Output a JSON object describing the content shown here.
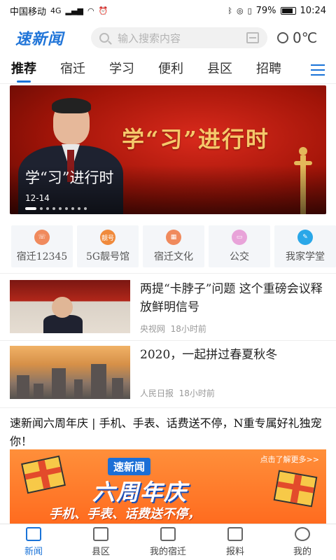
{
  "status": {
    "carrier": "中国移动",
    "network": "4G",
    "battery": "79%",
    "time": "10:24"
  },
  "header": {
    "logo": "速新闻",
    "search_placeholder": "输入搜索内容",
    "temperature": "0℃"
  },
  "tabs": [
    {
      "label": "推荐",
      "active": true
    },
    {
      "label": "宿迁"
    },
    {
      "label": "学习"
    },
    {
      "label": "便利"
    },
    {
      "label": "县区"
    },
    {
      "label": "招聘"
    }
  ],
  "banner": {
    "headline": "学“习”进行时",
    "caption": "学“习”进行时",
    "date": "12-14",
    "dot_count": 9
  },
  "services": [
    {
      "label": "宿迁12345",
      "icon": "hotline-icon",
      "color": "#f08a5d",
      "badge": ""
    },
    {
      "label": "5G靓号馆",
      "icon": "number-icon",
      "color": "#f08a3c",
      "badge": "靓号"
    },
    {
      "label": "宿迁文化",
      "icon": "culture-icon",
      "color": "#f08a5d",
      "badge": ""
    },
    {
      "label": "公交",
      "icon": "bus-icon",
      "color": "#e8a3d9",
      "badge": ""
    },
    {
      "label": "我家学堂",
      "icon": "school-icon",
      "color": "#2aa7e8",
      "badge": ""
    }
  ],
  "news": [
    {
      "title": "两提“卡脖子”问题 这个重磅会议释放鲜明信号",
      "source": "央视网",
      "time": "18小时前"
    },
    {
      "title": "2020，一起拼过春夏秋冬",
      "source": "人民日报",
      "time": "18小时前"
    }
  ],
  "promo": {
    "title": "速新闻六周年庆 | 手机、手表、话费送不停，N重专属好礼独宠你！",
    "brand": "速新闻",
    "headline": "六周年庆",
    "slogan": "手机、手表、话费送不停，",
    "more": "点击了解更多>>"
  },
  "bottom_nav": [
    {
      "label": "新闻",
      "icon": "news-icon",
      "active": true
    },
    {
      "label": "县区",
      "icon": "map-icon"
    },
    {
      "label": "我的宿迁",
      "icon": "building-icon"
    },
    {
      "label": "报料",
      "icon": "report-icon"
    },
    {
      "label": "我的",
      "icon": "profile-icon"
    }
  ]
}
